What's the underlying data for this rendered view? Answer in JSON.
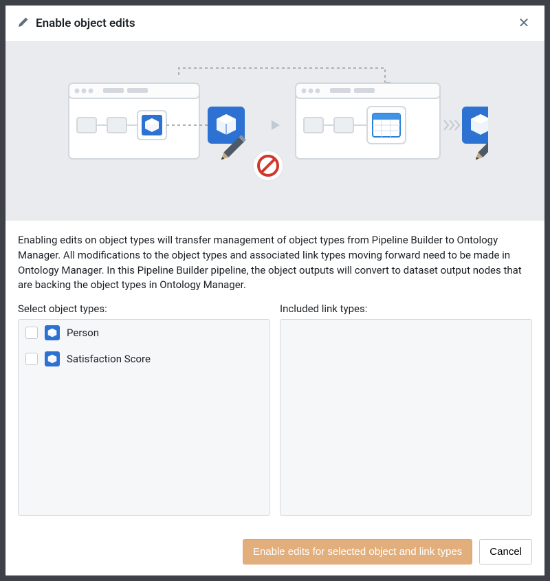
{
  "header": {
    "title": "Enable object edits"
  },
  "description": "Enabling edits on object types will transfer management of object types from Pipeline Builder to Ontology Manager. All modifications to the object types and associated link types moving forward need to be made in Ontology Manager. In this Pipeline Builder pipeline, the object outputs will convert to dataset output nodes that are backing the object types in Ontology Manager.",
  "selectLabel": "Select object types:",
  "includedLabel": "Included link types:",
  "objectTypes": [
    {
      "label": "Person"
    },
    {
      "label": "Satisfaction Score"
    }
  ],
  "buttons": {
    "primary": "Enable edits for selected object and link types",
    "cancel": "Cancel"
  }
}
